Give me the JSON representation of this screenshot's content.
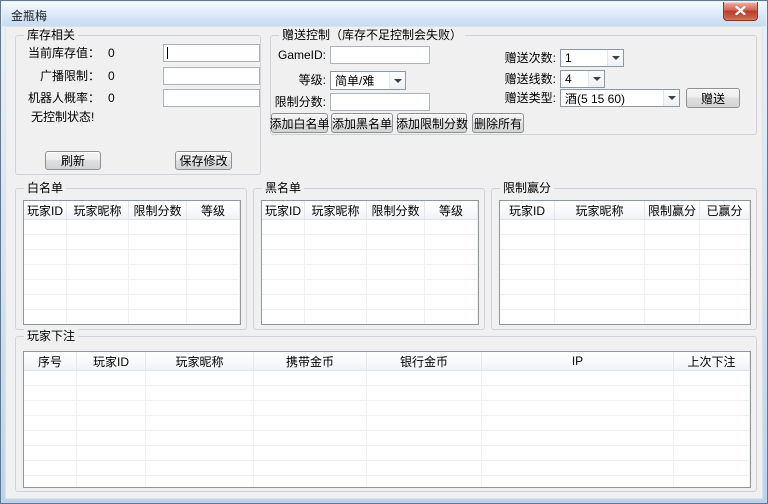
{
  "window": {
    "title": "金瓶梅"
  },
  "colors": {
    "titlebar_blue": "#cfe2f6",
    "client_bg": "#f0f0f0",
    "close_button_red": "#ba3b28",
    "list_border": "#8f969c",
    "grid_line": "#eef0f2",
    "group_border": "#d0d4da"
  },
  "inventory": {
    "title": "库存相关",
    "rows": [
      {
        "label": "当前库存值：",
        "value": "0",
        "input": ""
      },
      {
        "label": "广播限制：",
        "value": "0",
        "input": ""
      },
      {
        "label": "机器人概率：",
        "value": "0",
        "input": ""
      }
    ],
    "status": "无控制状态!",
    "refresh": "刷新",
    "save": "保存修改"
  },
  "gift": {
    "title": "赠送控制（库存不足控制会失败）",
    "gameid_label": "GameID:",
    "gameid_value": "",
    "level_label": "等级:",
    "level_value": "简单/难",
    "score_label": "限制分数:",
    "score_value": "",
    "add_white": "添加白名单",
    "add_black": "添加黑名单",
    "add_limit": "添加限制分数",
    "del_all": "删除所有",
    "times_label": "赠送次数:",
    "times_value": "1",
    "lines_label": "赠送线数:",
    "lines_value": "4",
    "type_label": "赠送类型:",
    "type_value": "酒(5 15 60)",
    "send": "赠送"
  },
  "whitelist": {
    "title": "白名单",
    "columns": [
      "玩家ID",
      "玩家昵称",
      "限制分数",
      "等级"
    ],
    "rows": []
  },
  "blacklist": {
    "title": "黑名单",
    "columns": [
      "玩家ID",
      "玩家昵称",
      "限制分数",
      "等级"
    ],
    "rows": []
  },
  "limitwin": {
    "title": "限制赢分",
    "columns": [
      "玩家ID",
      "玩家昵称",
      "限制赢分",
      "已赢分"
    ],
    "rows": []
  },
  "bets": {
    "title": "玩家下注",
    "columns": [
      "序号",
      "玩家ID",
      "玩家昵称",
      "携带金币",
      "银行金币",
      "IP",
      "上次下注"
    ],
    "rows": []
  }
}
